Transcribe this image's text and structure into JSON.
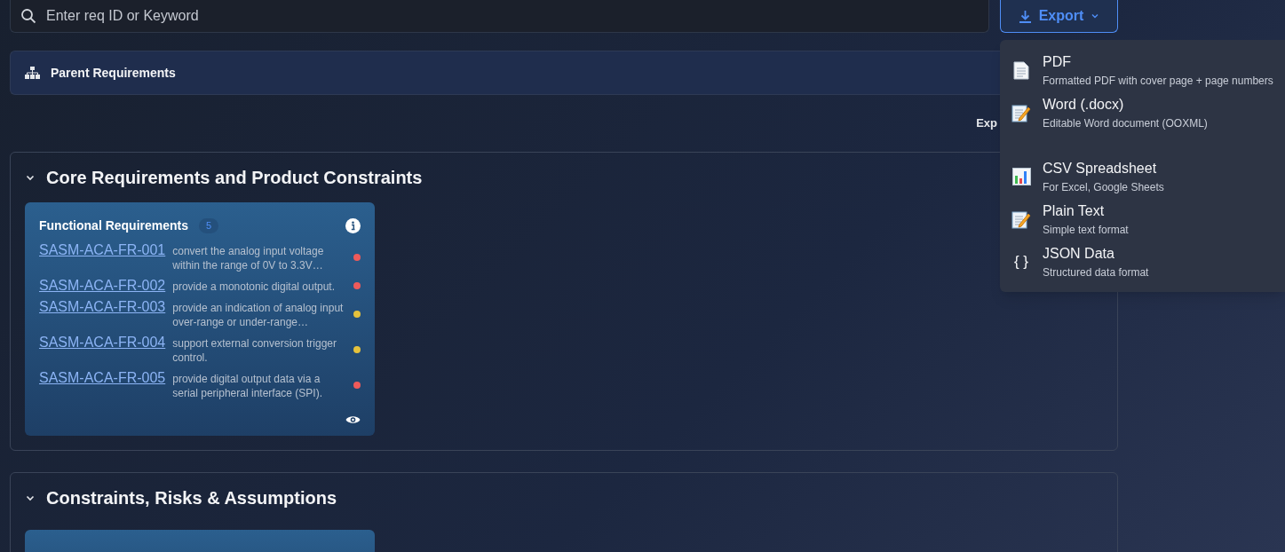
{
  "search": {
    "placeholder": "Enter req ID or Keyword"
  },
  "export_button": {
    "label": "Export",
    "expanded": true
  },
  "parent_requirements": {
    "title": "Parent Requirements"
  },
  "cut_label": "Exp",
  "sections": [
    {
      "title": "Core Requirements and Product Constraints",
      "expanded": true,
      "cards": [
        {
          "kind": "list",
          "title": "Functional Requirements",
          "count": "5",
          "items": [
            {
              "id": "SASM-ACA-FR-001",
              "text": "convert the analog input voltage within the range of 0V to 3.3V…",
              "color": "#ef5a5a"
            },
            {
              "id": "SASM-ACA-FR-002",
              "text": "provide a monotonic digital output.",
              "color": "#ef5a5a"
            },
            {
              "id": "SASM-ACA-FR-003",
              "text": "provide an indication of analog input over-range or under-range…",
              "color": "#e5c23c"
            },
            {
              "id": "SASM-ACA-FR-004",
              "text": "support external conversion trigger control.",
              "color": "#e5c23c"
            },
            {
              "id": "SASM-ACA-FR-005",
              "text": "provide digital output data via a serial peripheral interface (SPI).",
              "color": "#ef5a5a"
            }
          ]
        }
      ]
    },
    {
      "title": "Constraints, Risks & Assumptions",
      "expanded": true,
      "cards": [
        {
          "kind": "cut_off"
        }
      ]
    }
  ],
  "export_menu": [
    {
      "kind": "pdf",
      "title": "PDF",
      "description": "Formatted PDF with cover page + page numbers"
    },
    {
      "kind": "word",
      "title": "Word (.docx)",
      "description": "Editable Word document (OOXML)"
    },
    {
      "kind": "csv",
      "title": "CSV Spreadsheet",
      "description": "For Excel, Google Sheets"
    },
    {
      "kind": "text",
      "title": "Plain Text",
      "description": "Simple text format"
    },
    {
      "kind": "json",
      "title": "JSON Data",
      "description": "Structured data format",
      "glyph": "{ }"
    }
  ]
}
